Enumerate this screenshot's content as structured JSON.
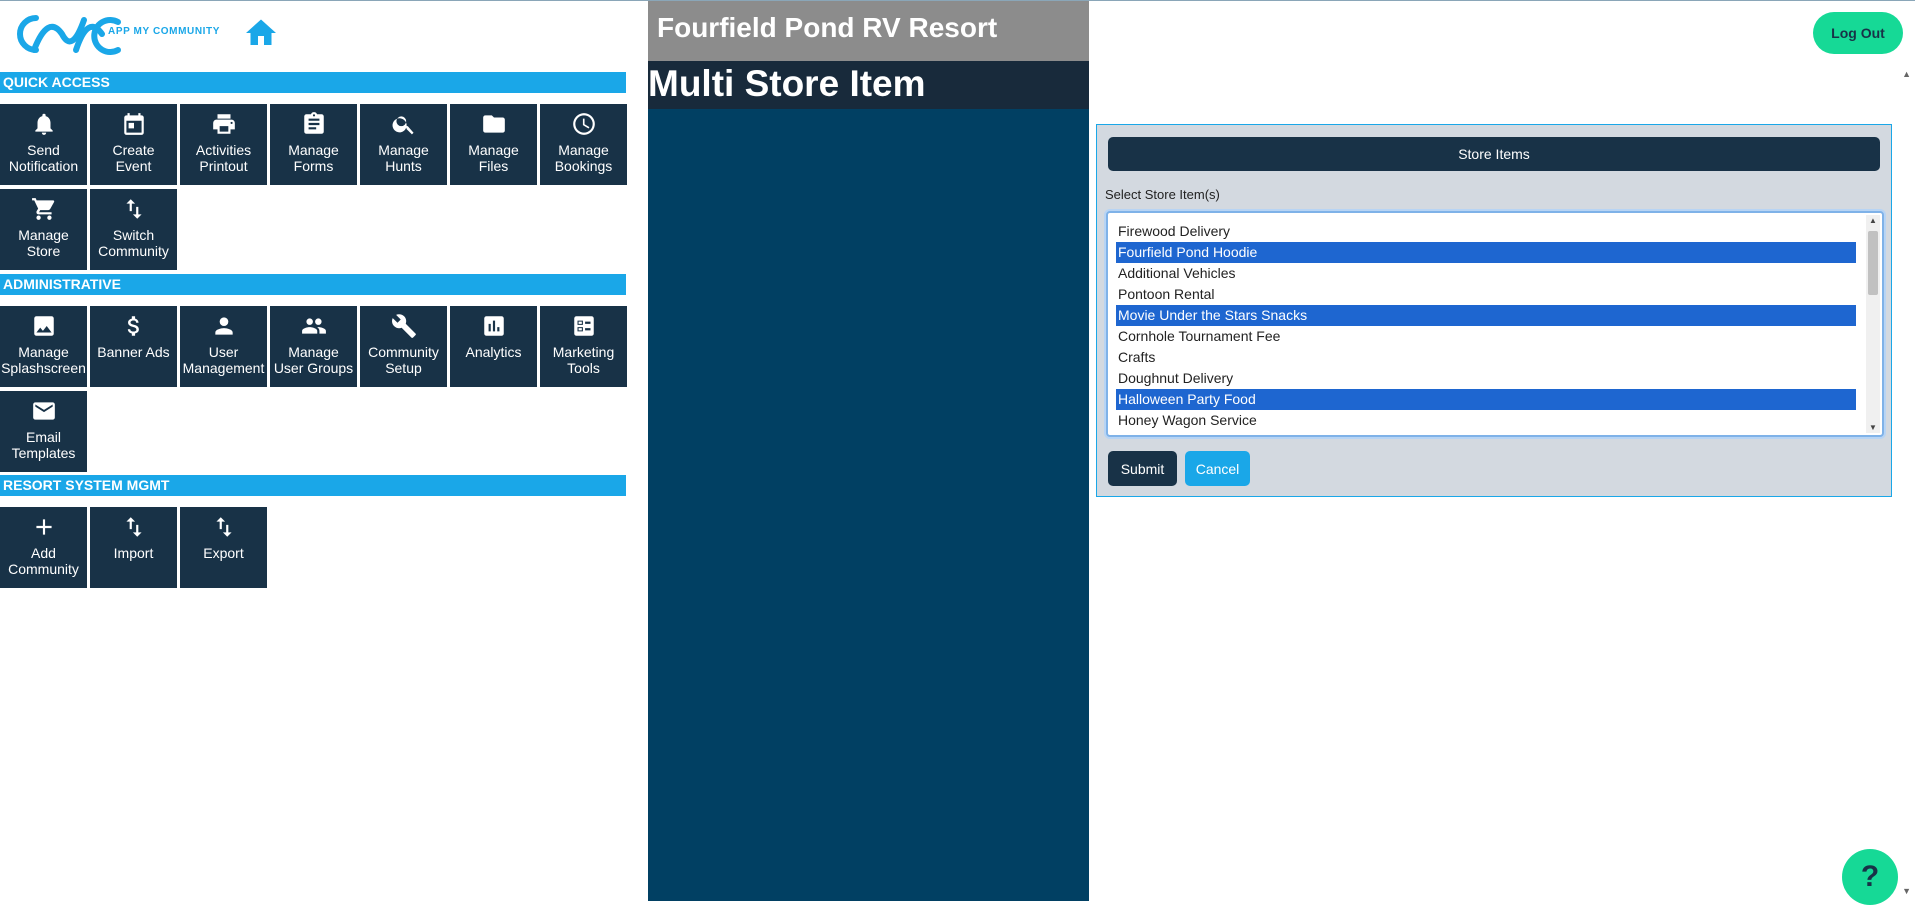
{
  "brand": {
    "logo_text": "APP MY COMMUNITY",
    "accent": "#1aa7e8",
    "dark": "#183247",
    "green": "#16d996"
  },
  "sections": {
    "quick_access": "QUICK ACCESS",
    "administrative": "ADMINISTRATIVE",
    "resort": "RESORT SYSTEM MGMT"
  },
  "quick_access": [
    {
      "label": "Send\nNotification",
      "icon": "bell-icon"
    },
    {
      "label": "Create\nEvent",
      "icon": "calendar-icon"
    },
    {
      "label": "Activities\nPrintout",
      "icon": "printer-icon"
    },
    {
      "label": "Manage\nForms",
      "icon": "clipboard-icon"
    },
    {
      "label": "Manage\nHunts",
      "icon": "search-icon"
    },
    {
      "label": "Manage\nFiles",
      "icon": "folder-icon"
    },
    {
      "label": "Manage\nBookings",
      "icon": "clock-icon"
    },
    {
      "label": "Manage\nStore",
      "icon": "cart-icon"
    },
    {
      "label": "Switch\nCommunity",
      "icon": "swap-icon"
    }
  ],
  "administrative": [
    {
      "label": "Manage\nSplashscreen",
      "icon": "image-icon"
    },
    {
      "label": "Banner Ads",
      "icon": "dollar-icon"
    },
    {
      "label": "User\nManagement",
      "icon": "user-icon"
    },
    {
      "label": "Manage\nUser Groups",
      "icon": "users-icon"
    },
    {
      "label": "Community\nSetup",
      "icon": "wrench-icon"
    },
    {
      "label": "Analytics",
      "icon": "chart-icon"
    },
    {
      "label": "Marketing\nTools",
      "icon": "checklist-icon"
    },
    {
      "label": "Email\nTemplates",
      "icon": "mail-icon"
    }
  ],
  "resort": [
    {
      "label": "Add\nCommunity",
      "icon": "plus-icon"
    },
    {
      "label": "Import",
      "icon": "import-icon"
    },
    {
      "label": "Export",
      "icon": "export-icon"
    }
  ],
  "middle": {
    "resort_name": "Fourfield Pond RV Resort",
    "page_title": "Multi Store Item"
  },
  "header": {
    "logout_label": "Log Out"
  },
  "form": {
    "header": "Store Items",
    "select_label": "Select Store Item(s)",
    "items": [
      {
        "label": "Firewood Delivery",
        "selected": false
      },
      {
        "label": "Fourfield Pond Hoodie",
        "selected": true
      },
      {
        "label": "Additional Vehicles",
        "selected": false
      },
      {
        "label": "Pontoon Rental",
        "selected": false
      },
      {
        "label": "Movie Under the Stars Snacks",
        "selected": true
      },
      {
        "label": "Cornhole Tournament Fee",
        "selected": false
      },
      {
        "label": "Crafts",
        "selected": false
      },
      {
        "label": "Doughnut Delivery",
        "selected": false
      },
      {
        "label": "Halloween Party Food",
        "selected": true
      },
      {
        "label": "Honey Wagon Service",
        "selected": false
      }
    ],
    "submit_label": "Submit",
    "cancel_label": "Cancel"
  },
  "help_label": "?"
}
